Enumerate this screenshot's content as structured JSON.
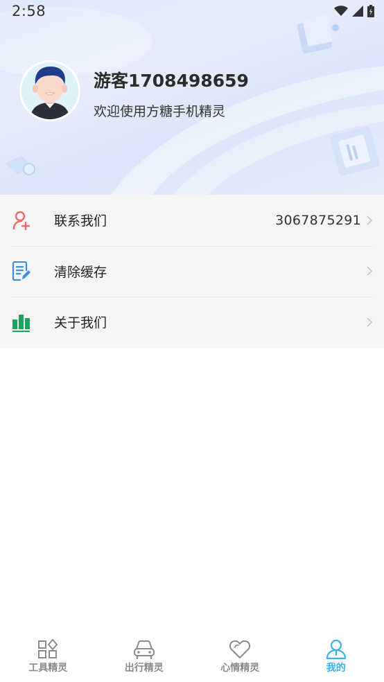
{
  "status_bar": {
    "time": "2:58"
  },
  "profile": {
    "name": "游客1708498659",
    "welcome": "欢迎使用方糖手机精灵"
  },
  "menu": {
    "items": [
      {
        "label": "联系我们",
        "value": "3067875291",
        "icon": "add-contact-icon",
        "icon_color": "#f0686a"
      },
      {
        "label": "清除缓存",
        "value": "",
        "icon": "document-edit-icon",
        "icon_color": "#3a8fd9"
      },
      {
        "label": "关于我们",
        "value": "",
        "icon": "bar-chart-icon",
        "icon_color": "#1aa35e"
      }
    ]
  },
  "tabbar": {
    "active_color": "#39b0ec",
    "inactive_color": "#8a8a8a",
    "tabs": [
      {
        "label": "工具精灵",
        "icon": "grid-apps-icon",
        "active": false
      },
      {
        "label": "出行精灵",
        "icon": "car-icon",
        "active": false
      },
      {
        "label": "心情精灵",
        "icon": "heart-icon",
        "active": false
      },
      {
        "label": "我的",
        "icon": "profile-icon",
        "active": true
      }
    ]
  }
}
